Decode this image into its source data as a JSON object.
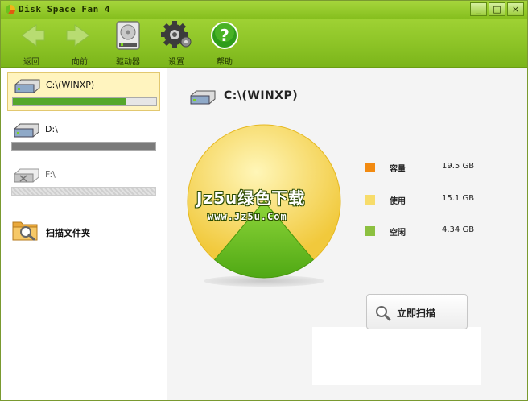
{
  "window": {
    "title": "Disk Space Fan 4",
    "controls": [
      "_",
      "□",
      "×"
    ]
  },
  "toolbar": {
    "back_label": "返回",
    "forward_label": "向前",
    "drives_label": "驱动器",
    "settings_label": "设置",
    "help_label": "帮助"
  },
  "sidebar": {
    "drives": [
      {
        "name": "C:\\(WINXP)",
        "used_fraction": 0.79,
        "selected": true,
        "bar_color": "#55a82a"
      },
      {
        "name": "D:\\",
        "used_fraction": 1.0,
        "selected": false,
        "bar_color": "#7a7a7a"
      },
      {
        "name": "F:\\",
        "used_fraction": 0.0,
        "selected": false,
        "disabled": true,
        "bar_color": "#d8d8d8"
      }
    ],
    "scan_folder_label": "扫描文件夹"
  },
  "main": {
    "drive_title": "C:\\(WINXP)",
    "watermark": "Jz5u绿色下载",
    "watermark_url": "www.Jz5u.Com",
    "scan_button_label": "立即扫描",
    "legend": [
      {
        "label": "容量",
        "value": "19.5 GB",
        "color": "#f28a10"
      },
      {
        "label": "使用",
        "value": "15.1 GB",
        "color": "#f7dc6a"
      },
      {
        "label": "空闲",
        "value": "4.34 GB",
        "color": "#8cc040"
      }
    ]
  },
  "chart_data": {
    "type": "pie",
    "categories": [
      "使用",
      "空闲"
    ],
    "values": [
      15.1,
      4.34
    ],
    "colors": [
      "#f7d75a",
      "#6ebd1c"
    ]
  }
}
